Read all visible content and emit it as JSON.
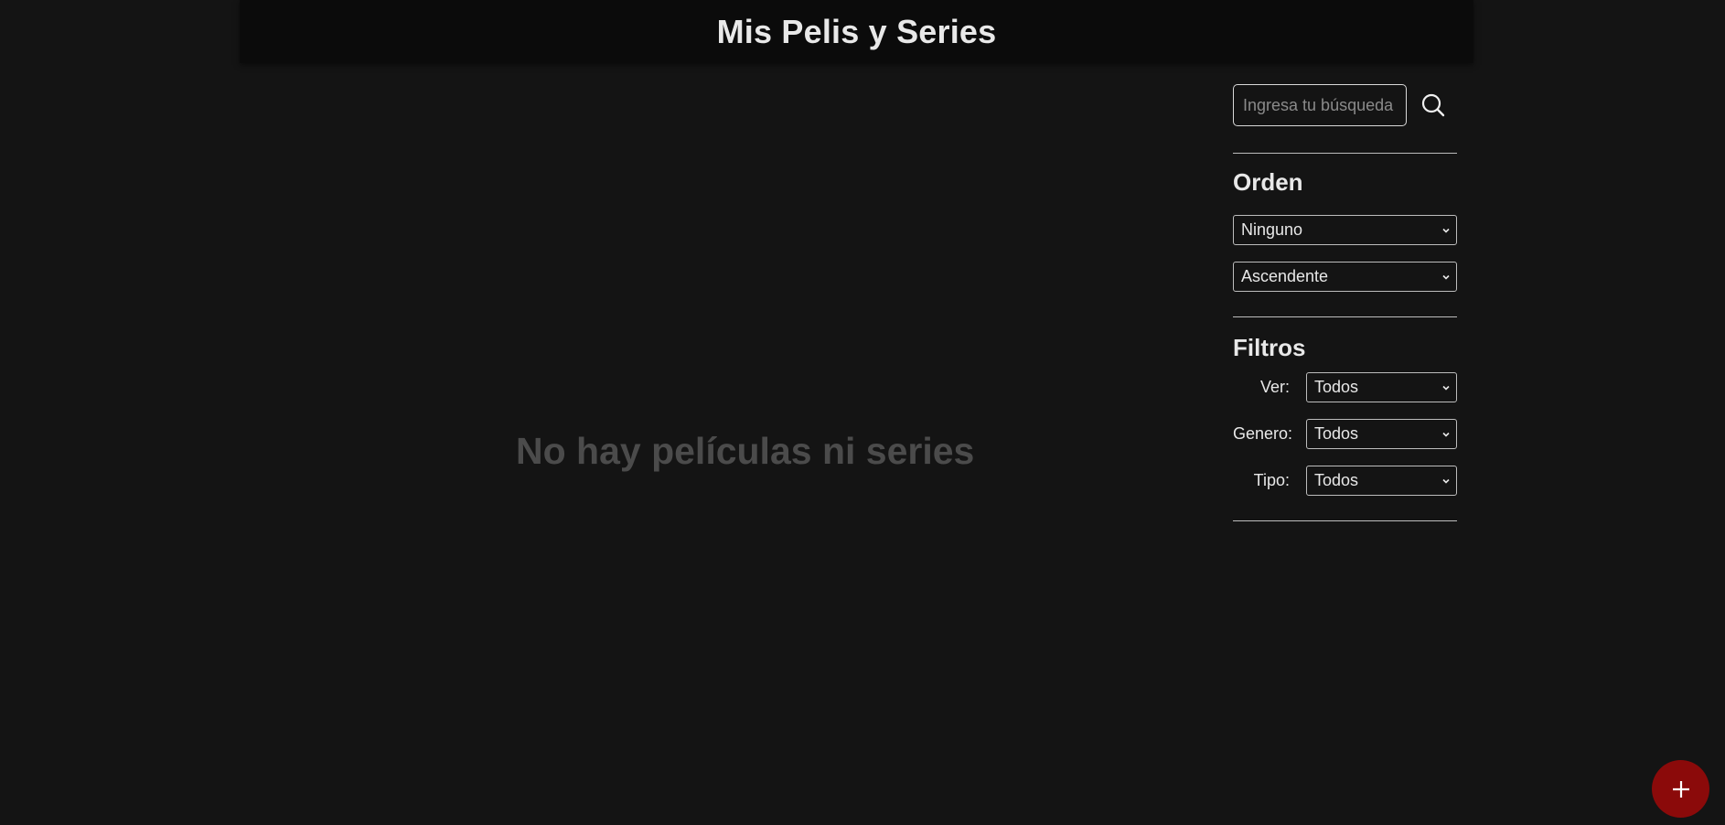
{
  "header": {
    "title": "Mis Pelis y Series"
  },
  "main": {
    "empty_message": "No hay películas ni series"
  },
  "search": {
    "placeholder": "Ingresa tu búsqueda",
    "icon": "search-icon"
  },
  "order": {
    "title": "Orden",
    "sort_by": "Ninguno",
    "direction": "Ascendente"
  },
  "filters": {
    "title": "Filtros",
    "ver": {
      "label": "Ver:",
      "value": "Todos"
    },
    "genero": {
      "label": "Genero:",
      "value": "Todos"
    },
    "tipo": {
      "label": "Tipo:",
      "value": "Todos"
    }
  },
  "fab": {
    "icon": "plus-icon",
    "color": "#8b0a0a"
  },
  "colors": {
    "background": "#141414",
    "header_bg": "#0b0b0b",
    "accent": "#8b0a0a"
  }
}
